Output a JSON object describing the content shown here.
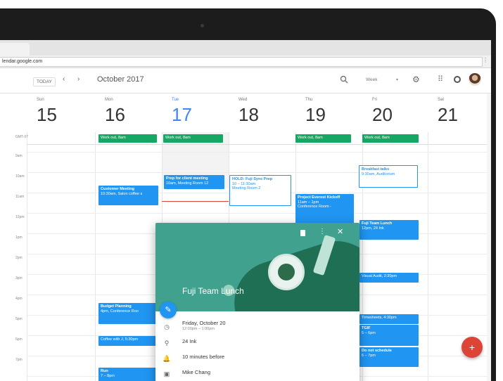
{
  "browser": {
    "url": "lendar.google.com",
    "menu_glyph": "⋮"
  },
  "toolbar": {
    "today_label": "TODAY",
    "prev_glyph": "‹",
    "next_glyph": "›",
    "month_title": "October 2017",
    "view_label": "Week",
    "view_caret": "▾",
    "gear_glyph": "⚙",
    "apps_glyph": "⠿"
  },
  "days": [
    {
      "dow": "Sun",
      "num": "15"
    },
    {
      "dow": "Mon",
      "num": "16"
    },
    {
      "dow": "Tue",
      "num": "17"
    },
    {
      "dow": "Wed",
      "num": "18"
    },
    {
      "dow": "Thu",
      "num": "19"
    },
    {
      "dow": "Fri",
      "num": "20"
    },
    {
      "dow": "Sat",
      "num": "21"
    }
  ],
  "time_labels": [
    "GMT-07",
    "9am",
    "10am",
    "11am",
    "12pm",
    "1pm",
    "2pm",
    "3pm",
    "4pm",
    "5pm",
    "6pm",
    "7pm"
  ],
  "events": {
    "workout_mon": "Work out, 8am",
    "workout_tue": "Work out, 8am",
    "workout_thu": "Work out, 8am",
    "workout_fri": "Work out, 8am",
    "prep_title": "Prep for client meeting",
    "prep_sub": "10am, Meeting Room 12",
    "hold_title": "HOLD: Fuji Sync Prep",
    "hold_sub1": "10 – 11:30am",
    "hold_sub2": "Meeting Room 2",
    "breakfast_title": "Breakfast talks",
    "breakfast_sub": "9:30am, Auditorium",
    "customer_title": "Customer Meeting",
    "customer_sub": "10:30am, Salon coffee s",
    "everest_title": "Project Everest Kickoff",
    "everest_sub1": "11am – 1pm",
    "everest_sub2": "Conference Room -",
    "fuji_title": "Fuji Team Lunch",
    "fuji_sub": "12pm, 24 Ink",
    "visual_audit": "Visual Audit, 2:30pm",
    "budget_title": "Budget Planning",
    "budget_sub": "4pm, Conference Roo",
    "timesheets": "Timesheets, 4:30pm",
    "tgif_title": "TGIF",
    "tgif_sub": "5 – 6pm",
    "coffee": "Coffee with J, 5:30pm",
    "dns_title": "Do not schedule",
    "dns_sub": "6 – 7pm",
    "run_title": "Run",
    "run_sub": "7 – 8pm"
  },
  "popup": {
    "title": "Fuji Team Lunch",
    "date": "Friday, October 20",
    "time": "12:00pm – 1:00pm",
    "location": "24 Ink",
    "reminder": "10 minutes before",
    "owner": "Mike Chang",
    "more_glyph": "⋮",
    "close_glyph": "✕",
    "edit_glyph": "✎",
    "clock_glyph": "◷",
    "pin_glyph": "⚲",
    "bell_glyph": "🔔",
    "calendar_glyph": "▣"
  },
  "fab_glyph": "+"
}
